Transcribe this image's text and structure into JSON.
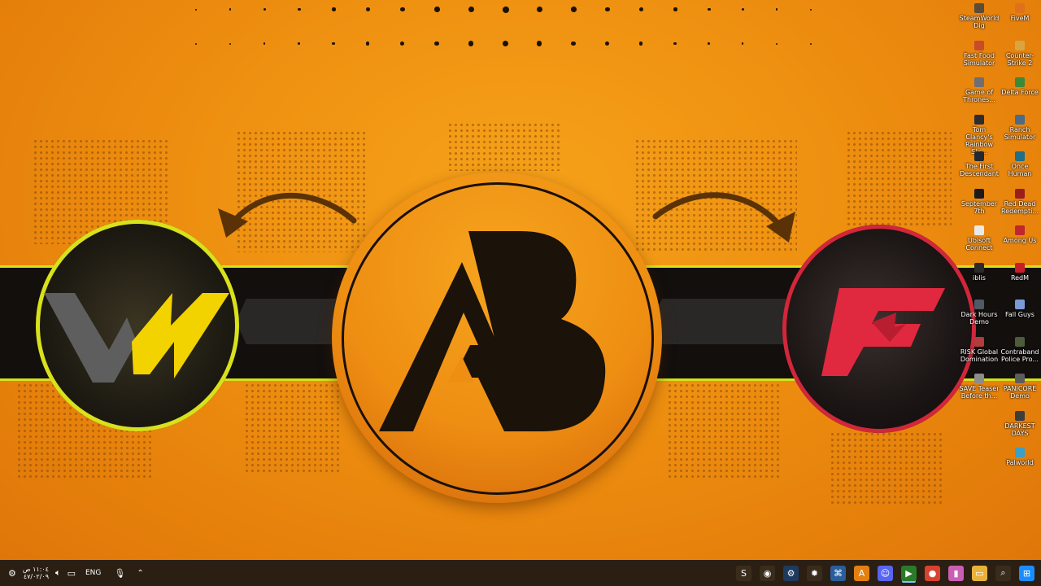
{
  "desktop_icons": [
    {
      "label": "SteamWorld Dig",
      "color": "#5a4b3a",
      "col": 0,
      "row": 0
    },
    {
      "label": "FiveM",
      "color": "#e0711c",
      "col": 1,
      "row": 0
    },
    {
      "label": "Fast Food Simulator",
      "color": "#c94b2a",
      "col": 0,
      "row": 1
    },
    {
      "label": "Counter-Strike 2",
      "color": "#d9a441",
      "col": 1,
      "row": 1
    },
    {
      "label": "Game of Thrones...",
      "color": "#6d6f75",
      "col": 0,
      "row": 2
    },
    {
      "label": "Delta Force",
      "color": "#3b8a3a",
      "col": 1,
      "row": 2
    },
    {
      "label": "Tom Clancy's Rainbow Six...",
      "color": "#2d2d2d",
      "col": 0,
      "row": 3
    },
    {
      "label": "Ranch Simulator",
      "color": "#4a6b8a",
      "col": 1,
      "row": 3
    },
    {
      "label": "The First Descendant",
      "color": "#222831",
      "col": 0,
      "row": 4
    },
    {
      "label": "Once Human",
      "color": "#1f6e8a",
      "col": 1,
      "row": 4
    },
    {
      "label": "September 7th",
      "color": "#1b1b1b",
      "col": 0,
      "row": 5
    },
    {
      "label": "Red Dead Redempti...",
      "color": "#9b1d1d",
      "col": 1,
      "row": 5
    },
    {
      "label": "Ubisoft Connect",
      "color": "#e9e9e9",
      "col": 0,
      "row": 6
    },
    {
      "label": "Among Us",
      "color": "#c0262d",
      "col": 1,
      "row": 6
    },
    {
      "label": "iblis",
      "color": "#2b2b2b",
      "col": 0,
      "row": 7
    },
    {
      "label": "RedM",
      "color": "#c81e2b",
      "col": 1,
      "row": 7
    },
    {
      "label": "Dark Hours Demo",
      "color": "#4f5a66",
      "col": 0,
      "row": 8
    },
    {
      "label": "Fall Guys",
      "color": "#7a9ad6",
      "col": 1,
      "row": 8
    },
    {
      "label": "RISK Global Domination",
      "color": "#b03c3c",
      "col": 0,
      "row": 9
    },
    {
      "label": "Contraband Police Pro...",
      "color": "#4d5c3a",
      "col": 1,
      "row": 9
    },
    {
      "label": "SAVE Teaser Before th...",
      "color": "#8c8c8c",
      "col": 0,
      "row": 10
    },
    {
      "label": "PANICORE Demo",
      "color": "#5c5c5c",
      "col": 1,
      "row": 10
    },
    {
      "label": "DARKEST DAYS",
      "color": "#3d3d3d",
      "col": 1,
      "row": 11
    },
    {
      "label": "Palworld",
      "color": "#3aa0c8",
      "col": 1,
      "row": 12
    }
  ],
  "logos": {
    "left": {
      "text": "VN",
      "accent": "#f2d300"
    },
    "center": {
      "text": "AB",
      "accent": "#1b1209"
    },
    "right": {
      "text": "F",
      "accent": "#e0283e"
    }
  },
  "taskbar": {
    "clock_time": "١١:٠٤ ص",
    "clock_date": "٤٧/٠٢/٠٩",
    "language": "ENG",
    "apps": [
      {
        "name": "sitemap-icon",
        "glyph": "S",
        "color": "#3a2c1c"
      },
      {
        "name": "obs-icon",
        "glyph": "◉",
        "color": "#3a2c1c"
      },
      {
        "name": "steam-icon",
        "glyph": "⚙",
        "color": "#1e3a5f"
      },
      {
        "name": "settings-icon",
        "glyph": "✹",
        "color": "#3a2c1c"
      },
      {
        "name": "network-icon",
        "glyph": "⌘",
        "color": "#2a5d9c"
      },
      {
        "name": "ab-app-icon",
        "glyph": "A",
        "color": "#e48011"
      },
      {
        "name": "discord-icon",
        "glyph": "☺",
        "color": "#5865f2"
      },
      {
        "name": "terminal-icon",
        "glyph": "▶",
        "color": "#2a7a2a"
      },
      {
        "name": "chrome-icon",
        "glyph": "●",
        "color": "#d8432f"
      },
      {
        "name": "color-app-icon",
        "glyph": "▮",
        "color": "#c95fb2"
      },
      {
        "name": "folder-icon",
        "glyph": "▭",
        "color": "#e8b23a"
      },
      {
        "name": "search-icon",
        "glyph": "⌕",
        "color": "#3a2c1c"
      },
      {
        "name": "start-icon",
        "glyph": "⊞",
        "color": "#1a8cff"
      }
    ]
  }
}
